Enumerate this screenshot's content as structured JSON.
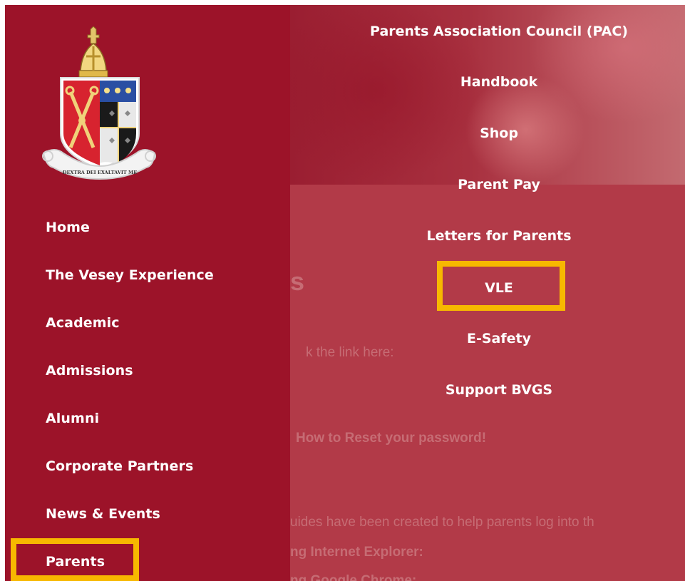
{
  "nav": {
    "items": [
      {
        "label": "Home"
      },
      {
        "label": "The Vesey Experience"
      },
      {
        "label": "Academic"
      },
      {
        "label": "Admissions"
      },
      {
        "label": "Alumni"
      },
      {
        "label": "Corporate Partners"
      },
      {
        "label": "News & Events"
      },
      {
        "label": "Parents"
      }
    ],
    "active": "Parents"
  },
  "submenu": {
    "items": [
      {
        "label": "Parents Association Council (PAC)"
      },
      {
        "label": "Handbook"
      },
      {
        "label": "Shop"
      },
      {
        "label": "Parent Pay"
      },
      {
        "label": "Letters for Parents"
      },
      {
        "label": "VLE"
      },
      {
        "label": "E-Safety"
      },
      {
        "label": "Support BVGS"
      }
    ],
    "highlighted": "VLE"
  },
  "background_page": {
    "heading_fragment": "s",
    "lines": [
      "k the link here:",
      "How to Reset your password!",
      "uides have been created to help parents log into th",
      "ng Internet Explorer:",
      "ng Google Chrome:"
    ]
  },
  "crest": {
    "motto": "DEXTRA DEI EXALTAVIT ME",
    "icon": "school-crest-icon"
  },
  "colors": {
    "sidebar": "#9c1329",
    "overlay": "#a32a3c",
    "text": "#ffffff",
    "highlight": "#f7b800"
  }
}
